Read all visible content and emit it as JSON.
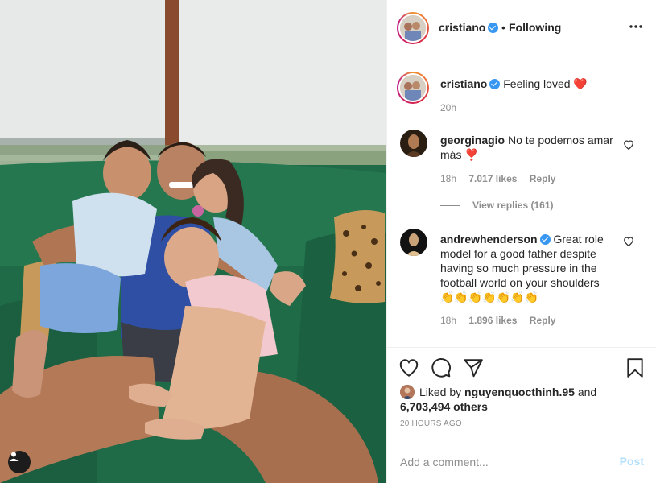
{
  "post": {
    "username": "cristiano",
    "follow_status": "Following",
    "separator": "•",
    "caption": "Feeling loved ❤️",
    "caption_time": "20h"
  },
  "comments": [
    {
      "username": "georginagio",
      "text": "No te podemos amar más ❣️",
      "time": "18h",
      "likes": "7.017 likes",
      "reply_label": "Reply",
      "view_replies": "View replies (161)"
    },
    {
      "username": "andrewhenderson",
      "verified": true,
      "text": "Great role model for a good father despite having so much pressure in the football world on your shoulders👏👏👏👏👏👏👏",
      "time": "18h",
      "likes": "1.896 likes",
      "reply_label": "Reply"
    }
  ],
  "likes": {
    "prefix": "Liked by",
    "liker": "nguyenquocthinh.95",
    "joiner": "and",
    "others": "6,703,494 others"
  },
  "posted_ago": "20 HOURS AGO",
  "add_comment": {
    "placeholder": "Add a comment...",
    "post_label": "Post"
  },
  "colors": {
    "verified": "#3897f0",
    "sofa": "#1f6b48",
    "post_disabled": "#b2dffc"
  },
  "icons": [
    "more-options-icon",
    "heart-icon",
    "comment-icon",
    "share-icon",
    "bookmark-icon",
    "user-tag-icon",
    "verified-badge-icon"
  ]
}
